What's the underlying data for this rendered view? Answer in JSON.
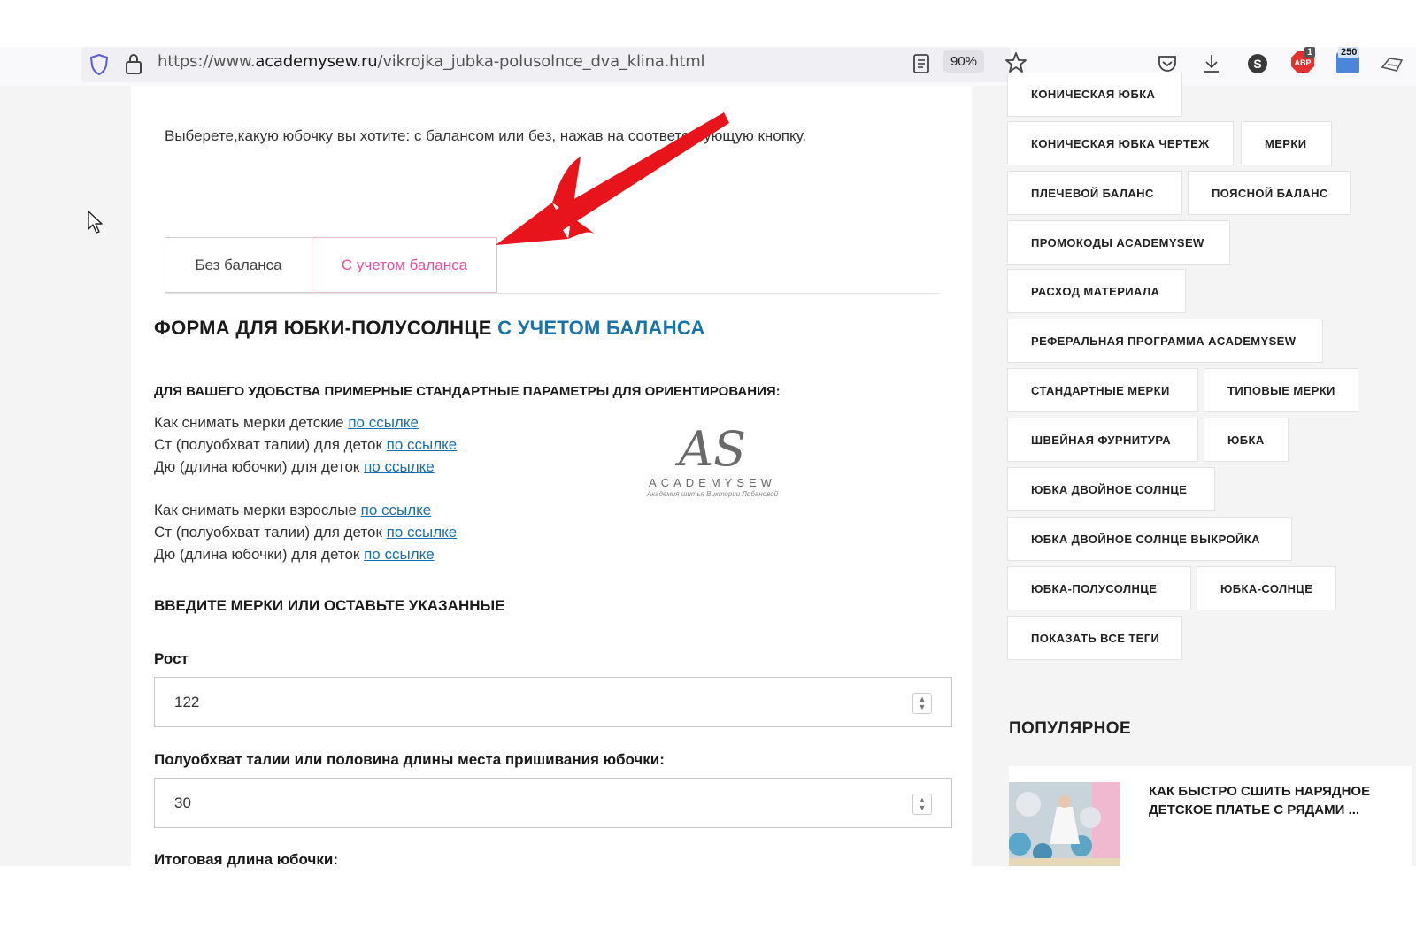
{
  "browser": {
    "url_prefix": "https://www.",
    "url_domain": "academysew.ru",
    "url_path": "/vikrojka_jubka-polusolnce_dva_klina.html",
    "zoom": "90%",
    "s_avatar": "S",
    "abp_label": "ABP",
    "abp_badge": "1",
    "ext_badge": "250"
  },
  "content": {
    "intro": "Выберете,какую юбочку вы хотите: с балансом или без, нажав на соответствующую кнопку.",
    "tabs": [
      {
        "label": "Без баланса",
        "active": false
      },
      {
        "label": "С учетом баланса",
        "active": true
      }
    ],
    "form_title_main": "ФОРМА ДЛЯ ЮБКИ-ПОЛУСОЛНЦЕ",
    "form_title_accent": "С УЧЕТОМ БАЛАНСА",
    "params_heading": "ДЛЯ ВАШЕГО УДОБСТВА ПРИМЕРНЫЕ СТАНДАРТНЫЕ ПАРАМЕТРЫ ДЛЯ ОРИЕНТИРОВАНИЯ:",
    "kids_rows": [
      {
        "text": "Как снимать мерки детские ",
        "link": "по ссылке"
      },
      {
        "text": "Ст (полуобхват талии) для деток ",
        "link": "по ссылке"
      },
      {
        "text": "Дю (длина юбочки) для деток ",
        "link": "по ссылке"
      }
    ],
    "adult_rows": [
      {
        "text": "Как снимать мерки взрослые ",
        "link": "по ссылке"
      },
      {
        "text": "Ст (полуобхват талии) для деток ",
        "link": "по ссылке"
      },
      {
        "text": "Дю (длина юбочки) для деток ",
        "link": "по ссылке"
      }
    ],
    "watermark": {
      "logo": "AS",
      "name": "ACADEMYSEW",
      "sub": "Академия шитья Виктории Лобановой"
    },
    "enter_heading": "ВВЕДИТЕ МЕРКИ ИЛИ ОСТАВЬТЕ УКАЗАННЫЕ",
    "fields": [
      {
        "label": "Рост",
        "value": "122"
      },
      {
        "label": "Полуобхват талии или половина длины места пришивания юбочки:",
        "value": "30"
      },
      {
        "label": "Итоговая длина юбочки:"
      }
    ]
  },
  "sidebar": {
    "tags": [
      "КОНИЧЕСКАЯ ЮБКА",
      "КОНИЧЕСКАЯ ЮБКА ЧЕРТЕЖ",
      "МЕРКИ",
      "ПЛЕЧЕВОЙ БАЛАНС",
      "ПОЯСНОЙ БАЛАНС",
      "ПРОМОКОДЫ ACADEMYSEW",
      "РАСХОД МАТЕРИАЛА",
      "РЕФЕРАЛЬНАЯ ПРОГРАММА ACADEMYSEW",
      "СТАНДАРТНЫЕ МЕРКИ",
      "ТИПОВЫЕ МЕРКИ",
      "ШВЕЙНАЯ ФУРНИТУРА",
      "ЮБКА",
      "ЮБКА ДВОЙНОЕ СОЛНЦЕ",
      "ЮБКА ДВОЙНОЕ СОЛНЦЕ ВЫКРОЙКА",
      "ЮБКА-ПОЛУСОЛНЦЕ",
      "ЮБКА-СОЛНЦЕ",
      "ПОКАЗАТЬ ВСЕ ТЕГИ"
    ],
    "popular_heading": "ПОПУЛЯРНОЕ",
    "popular_item": "КАК БЫСТРО СШИТЬ НАРЯДНОЕ ДЕТСКОЕ ПЛАТЬЕ С РЯДАМИ ..."
  },
  "colors": {
    "accent_blue": "#1a73a8",
    "active_tab_pink": "#e4539b",
    "annotation_red": "#e8141b",
    "link_blue": "#1a6fb0"
  }
}
